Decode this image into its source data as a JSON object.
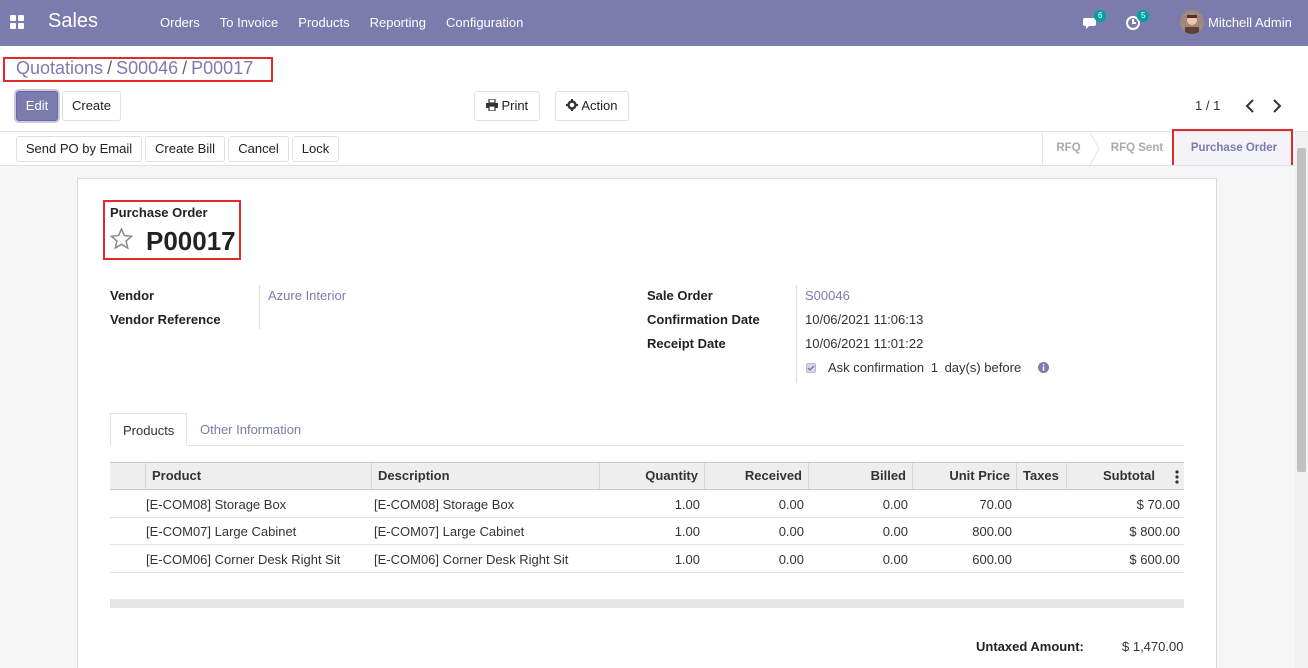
{
  "navbar": {
    "app_name": "Sales",
    "menu": [
      "Orders",
      "To Invoice",
      "Products",
      "Reporting",
      "Configuration"
    ],
    "messages_count": "6",
    "activities_count": "5",
    "user": "Mitchell Admin"
  },
  "breadcrumb": {
    "root": "Quotations",
    "parent": "S00046",
    "current": "P00017"
  },
  "buttons": {
    "edit": "Edit",
    "create": "Create",
    "print": "Print",
    "action": "Action",
    "send_po": "Send PO by Email",
    "create_bill": "Create Bill",
    "cancel": "Cancel",
    "lock": "Lock"
  },
  "pager": "1 / 1",
  "stages": [
    "RFQ",
    "RFQ Sent",
    "Purchase Order"
  ],
  "active_stage": "Purchase Order",
  "form": {
    "doc_type": "Purchase Order",
    "name": "P00017",
    "vendor_label": "Vendor",
    "vendor": "Azure Interior",
    "vendor_ref_label": "Vendor Reference",
    "vendor_ref": "",
    "sale_order_label": "Sale Order",
    "sale_order": "S00046",
    "confirmation_date_label": "Confirmation Date",
    "confirmation_date": "10/06/2021 11:06:13",
    "receipt_date_label": "Receipt Date",
    "receipt_date": "10/06/2021 11:01:22",
    "ask_confirmation_pre": "Ask confirmation",
    "ask_confirmation_days": "1",
    "ask_confirmation_post": "day(s) before",
    "ask_confirmation_checked": true
  },
  "tabs": [
    "Products",
    "Other Information"
  ],
  "table": {
    "headers": [
      "Product",
      "Description",
      "Quantity",
      "Received",
      "Billed",
      "Unit Price",
      "Taxes",
      "Subtotal"
    ],
    "rows": [
      {
        "product": "[E-COM08] Storage Box",
        "description": "[E-COM08] Storage Box",
        "quantity": "1.00",
        "received": "0.00",
        "billed": "0.00",
        "unit_price": "70.00",
        "taxes": "",
        "subtotal": "$ 70.00"
      },
      {
        "product": "[E-COM07] Large Cabinet",
        "description": "[E-COM07] Large Cabinet",
        "quantity": "1.00",
        "received": "0.00",
        "billed": "0.00",
        "unit_price": "800.00",
        "taxes": "",
        "subtotal": "$ 800.00"
      },
      {
        "product": "[E-COM06] Corner Desk Right Sit",
        "description": "[E-COM06] Corner Desk Right Sit",
        "quantity": "1.00",
        "received": "0.00",
        "billed": "0.00",
        "unit_price": "600.00",
        "taxes": "",
        "subtotal": "$ 600.00"
      }
    ]
  },
  "totals": {
    "untaxed_label": "Untaxed Amount:",
    "untaxed": "$ 1,470.00"
  },
  "colors": {
    "brand": "#7c7bad",
    "highlight": "#e02b2b"
  }
}
